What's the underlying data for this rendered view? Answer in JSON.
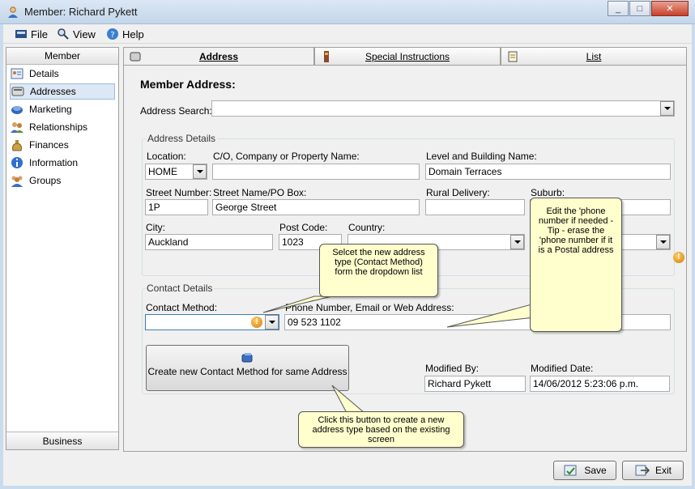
{
  "window": {
    "title": "Member: Richard Pykett",
    "minimize": "_",
    "maximize": "□",
    "close": "✕"
  },
  "menu": {
    "file": "File",
    "view": "View",
    "help": "Help"
  },
  "sidebar": {
    "header": "Member",
    "items": [
      {
        "label": "Details",
        "icon": "details-icon"
      },
      {
        "label": "Addresses",
        "icon": "addresses-icon"
      },
      {
        "label": "Marketing",
        "icon": "marketing-icon"
      },
      {
        "label": "Relationships",
        "icon": "relationships-icon"
      },
      {
        "label": "Finances",
        "icon": "finances-icon"
      },
      {
        "label": "Information",
        "icon": "information-icon"
      },
      {
        "label": "Groups",
        "icon": "groups-icon"
      }
    ],
    "footer": "Business"
  },
  "tabs": [
    {
      "label": "Address",
      "active": true
    },
    {
      "label": "Special Instructions",
      "active": false
    },
    {
      "label": "List",
      "active": false
    }
  ],
  "page": {
    "title": "Member Address:",
    "address_search_label": "Address Search:",
    "address_search_value": ""
  },
  "address_details": {
    "title": "Address Details",
    "location_label": "Location:",
    "location_value": "HOME",
    "co_label": "C/O, Company or Property Name:",
    "co_value": "",
    "level_label": "Level and Building Name:",
    "level_value": "Domain Terraces",
    "street_number_label": "Street Number:",
    "street_number_value": "1P",
    "street_name_label": "Street Name/PO Box:",
    "street_name_value": "George Street",
    "rural_label": "Rural Delivery:",
    "rural_value": "",
    "suburb_label": "Suburb:",
    "suburb_value": "",
    "city_label": "City:",
    "city_value": "Auckland",
    "postcode_label": "Post Code:",
    "postcode_value": "1023",
    "country_label": "Country:",
    "country_value": ""
  },
  "contact_details": {
    "title": "Contact Details",
    "method_label": "Contact Method:",
    "method_value": "",
    "phone_label": "Phone Number, Email or Web Address:",
    "phone_value": "09 523 1102",
    "create_button": "Create new Contact Method for same Address",
    "modified_by_label": "Modified By:",
    "modified_by_value": "Richard Pykett",
    "modified_date_label": "Modified Date:",
    "modified_date_value": "14/06/2012 5:23:06 p.m."
  },
  "callouts": {
    "contact_method": "Selcet the new address type (Contact Method) form the dropdown list",
    "phone": "Edit the 'phone number if needed - Tip - erase the 'phone number if it is a Postal address",
    "create_button": "Click this button to create a new address type based on the existing screen"
  },
  "footer": {
    "save": "Save",
    "exit": "Exit"
  },
  "colors": {
    "window_frame": "#c9dcee",
    "callout_bg": "#fffecd",
    "warning": "#d47a00"
  }
}
